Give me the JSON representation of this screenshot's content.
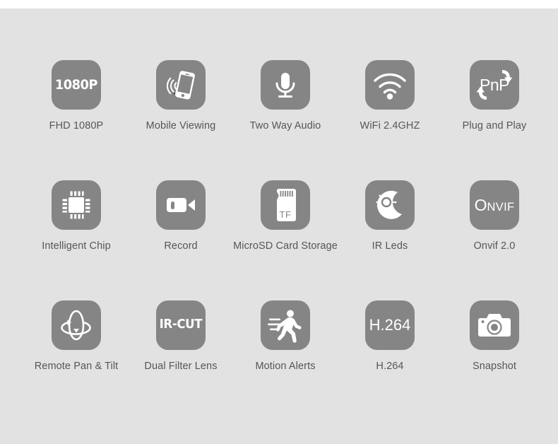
{
  "page": {
    "background_color": "#e2e2e2",
    "top_strip_color": "#ffffff",
    "tile_color": "#858585",
    "icon_color": "#ffffff",
    "label_color": "#565656"
  },
  "features": [
    [
      {
        "label": "FHD 1080P",
        "icon": "1080p-text-icon",
        "text": "1080P"
      },
      {
        "label": "Mobile Viewing",
        "icon": "mobile-phone-signal-icon",
        "text": ""
      },
      {
        "label": "Two Way Audio",
        "icon": "microphone-icon",
        "text": ""
      },
      {
        "label": "WiFi 2.4GHZ",
        "icon": "wifi-icon",
        "text": ""
      },
      {
        "label": "Plug and Play",
        "icon": "pnp-arrows-icon",
        "text": "PnP"
      }
    ],
    [
      {
        "label": "Intelligent Chip",
        "icon": "cpu-chip-icon",
        "text": ""
      },
      {
        "label": "Record",
        "icon": "video-camera-icon",
        "text": ""
      },
      {
        "label": "MicroSD Card Storage",
        "icon": "microsd-card-icon",
        "text": "TF"
      },
      {
        "label": "IR Leds",
        "icon": "sun-moon-icon",
        "text": ""
      },
      {
        "label": "Onvif 2.0",
        "icon": "onvif-text-icon",
        "text": "Onvif",
        "text_first": "O",
        "text_rest": "NVIF"
      }
    ],
    [
      {
        "label": "Remote Pan & Tilt",
        "icon": "pan-tilt-rotation-icon",
        "text": ""
      },
      {
        "label": "Dual Filter Lens",
        "icon": "ir-cut-text-icon",
        "text": "IR-CUT"
      },
      {
        "label": "Motion Alerts",
        "icon": "running-person-motion-icon",
        "text": ""
      },
      {
        "label": "H.264",
        "icon": "h264-text-icon",
        "text": "H.264"
      },
      {
        "label": "Snapshot",
        "icon": "photo-camera-icon",
        "text": ""
      }
    ]
  ]
}
